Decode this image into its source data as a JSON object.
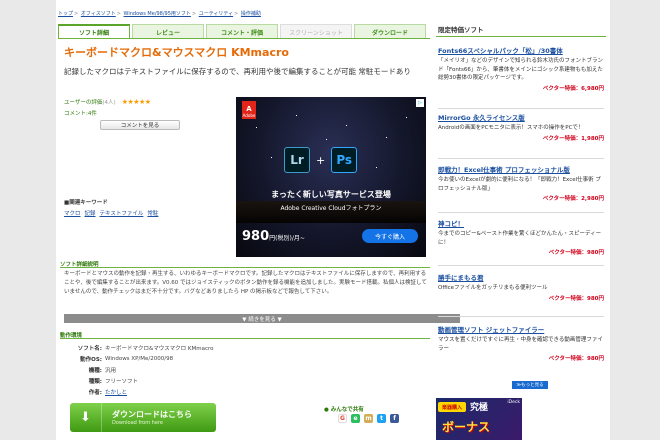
{
  "breadcrumb": [
    "トップ",
    "オフィスソフト",
    "Windows Me/98/95用ソフト",
    "ユーティリティ",
    "操作補助"
  ],
  "tabs": [
    {
      "label": "ソフト詳細",
      "state": "active"
    },
    {
      "label": "レビュー",
      "state": "normal"
    },
    {
      "label": "コメント・評価",
      "state": "normal"
    },
    {
      "label": "スクリーンショット",
      "state": "disabled"
    },
    {
      "label": "ダウンロード",
      "state": "normal"
    }
  ],
  "title": "キーボードマクロ&マウスマクロ KMmacro",
  "lead": "記録したマクロはテキストファイルに保存するので、再利用や後で編集することが可能 常駐モードあり",
  "rating": {
    "label": "ユーザーの評価",
    "count": "(4人)",
    "stars": "★★★★★",
    "comments": "コメント:4件",
    "comment_button": "コメントを見る"
  },
  "keywords": {
    "heading": "■関連キーワード",
    "links": [
      "マクロ",
      "記録",
      "テキストファイル",
      "常駐"
    ]
  },
  "ad": {
    "brand": "Adobe",
    "app1": "Lr",
    "app2": "Ps",
    "headline": "まったく新しい写真サービス登場",
    "sub": "Adobe Creative Cloudフォトプラン",
    "price": "980",
    "price_unit": "円(税別)/月~",
    "button": "今すぐ購入"
  },
  "desc": {
    "heading": "ソフト詳細説明",
    "text": "キーボードとマウスの動作を記録・再生する、いわゆるキーボードマクロです。記録したマクロはテキストファイルに保存しますので、再利用することや、後で編集することが出来ます。V0.60 ではジョイスティックのボタン動作を録る機能を追加しました。実験モード搭載。私個人は検証していませんので、動作チェックはまだ不十分です。バグなどありましたら HP の掲示板などで報告して下さい。",
    "more_button": "▼ 続きを見る ▼"
  },
  "env": {
    "heading": "動作環境",
    "rows": [
      {
        "k": "ソフト名:",
        "v": "キーボードマクロ&マウスマクロ KMmacro"
      },
      {
        "k": "動作OS:",
        "v": "Windows XP/Me/2000/98"
      },
      {
        "k": "機種:",
        "v": "汎用"
      },
      {
        "k": "種類:",
        "v": "フリーソフト"
      },
      {
        "k": "作者:",
        "v": "たかしと",
        "link": true
      }
    ]
  },
  "download": {
    "label": "ダウンロードはこちら",
    "sub": "Download from here"
  },
  "share": {
    "heading": "みんなで共有",
    "icons": [
      "google-icon",
      "evernote-icon",
      "mixi-icon",
      "twitter-icon",
      "facebook-icon"
    ]
  },
  "sidebar": {
    "heading": "限定特価ソフト",
    "items": [
      {
        "title": "Fonts66スペシャルパック「松」/30書体",
        "desc": "「メイリオ」などのデザインで知られる鈴木功氏のフォントブランド「Fonts66」から、筆書体をメインにゴシック系建物もも加えた総勢30書体の限定パッケージです。",
        "price": "ベクター特価：6,980円"
      },
      {
        "title": "MirrorGo 永久ライセンス版",
        "desc": "Androidの画面をPCモニタに表示！スマホの操作をPCで！",
        "price": "ベクター特価：1,980円"
      },
      {
        "title": "即戦力！Excel仕事術 プロフェッショナル版",
        "desc": "今お使いのExcelが劇的に便利になる！「即戦力！Excel仕事術 プロフェッショナル版」",
        "price": "ベクター特価：2,980円"
      },
      {
        "title": "神コピ！",
        "desc": "今までのコピー&ペースト作業を驚くほどかんたん・スピーディーに！",
        "price": "ベクター特価：980円"
      },
      {
        "title": "勝手にまもる君",
        "desc": "Officeファイルをガッチリまもる便利ツール",
        "price": "ベクター特価：980円"
      },
      {
        "title": "動画管理ソフト ジェットファイラー",
        "desc": "マウスを置くだけですぐに再生・中身を確認できる動画管理ファイラー",
        "price": "ベクター特価：980円"
      }
    ],
    "more_button": "≫もっと見る"
  },
  "side_ad": {
    "badge": "楽器購入",
    "word1": "究極",
    "word2": "ボーナス",
    "corner": "iDeck"
  },
  "colors": {
    "accent_green": "#6db33f",
    "title_orange": "#e56b09",
    "link_blue": "#1a4fa0",
    "price_red": "#d0001b"
  }
}
